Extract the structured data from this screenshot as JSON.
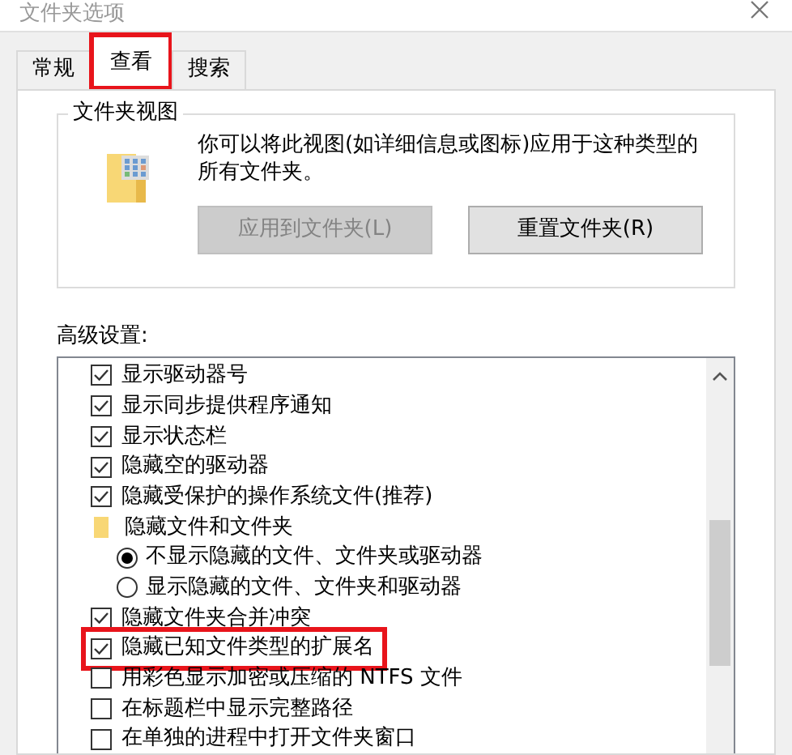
{
  "window": {
    "title": "文件夹选项"
  },
  "tabs": [
    {
      "label": "常规",
      "selected": false,
      "annotated": false
    },
    {
      "label": "查看",
      "selected": true,
      "annotated": true
    },
    {
      "label": "搜索",
      "selected": false,
      "annotated": false
    }
  ],
  "folder_views": {
    "title": "文件夹视图",
    "description": "你可以将此视图(如详细信息或图标)应用于这种类型的所有文件夹。",
    "buttons": [
      {
        "label": "应用到文件夹(L)",
        "disabled": true
      },
      {
        "label": "重置文件夹(R)",
        "disabled": false
      }
    ]
  },
  "advanced": {
    "label": "高级设置:",
    "items": [
      {
        "kind": "checkbox",
        "label": "显示驱动器号",
        "checked": true,
        "annotated": false
      },
      {
        "kind": "checkbox",
        "label": "显示同步提供程序通知",
        "checked": true,
        "annotated": false
      },
      {
        "kind": "checkbox",
        "label": "显示状态栏",
        "checked": true,
        "annotated": false
      },
      {
        "kind": "checkbox",
        "label": "隐藏空的驱动器",
        "checked": true,
        "annotated": false
      },
      {
        "kind": "checkbox",
        "label": "隐藏受保护的操作系统文件(推荐)",
        "checked": true,
        "annotated": false
      },
      {
        "kind": "folder",
        "label": "隐藏文件和文件夹"
      },
      {
        "kind": "radio",
        "label": "不显示隐藏的文件、文件夹或驱动器",
        "selected": true
      },
      {
        "kind": "radio",
        "label": "显示隐藏的文件、文件夹和驱动器",
        "selected": false
      },
      {
        "kind": "checkbox",
        "label": "隐藏文件夹合并冲突",
        "checked": true,
        "annotated": false
      },
      {
        "kind": "checkbox",
        "label": "隐藏已知文件类型的扩展名",
        "checked": true,
        "annotated": true
      },
      {
        "kind": "checkbox",
        "label": "用彩色显示加密或压缩的 NTFS 文件",
        "checked": false,
        "annotated": false
      },
      {
        "kind": "checkbox",
        "label": "在标题栏中显示完整路径",
        "checked": false,
        "annotated": false
      },
      {
        "kind": "checkbox",
        "label": "在单独的进程中打开文件夹窗口",
        "checked": false,
        "annotated": false
      }
    ]
  }
}
